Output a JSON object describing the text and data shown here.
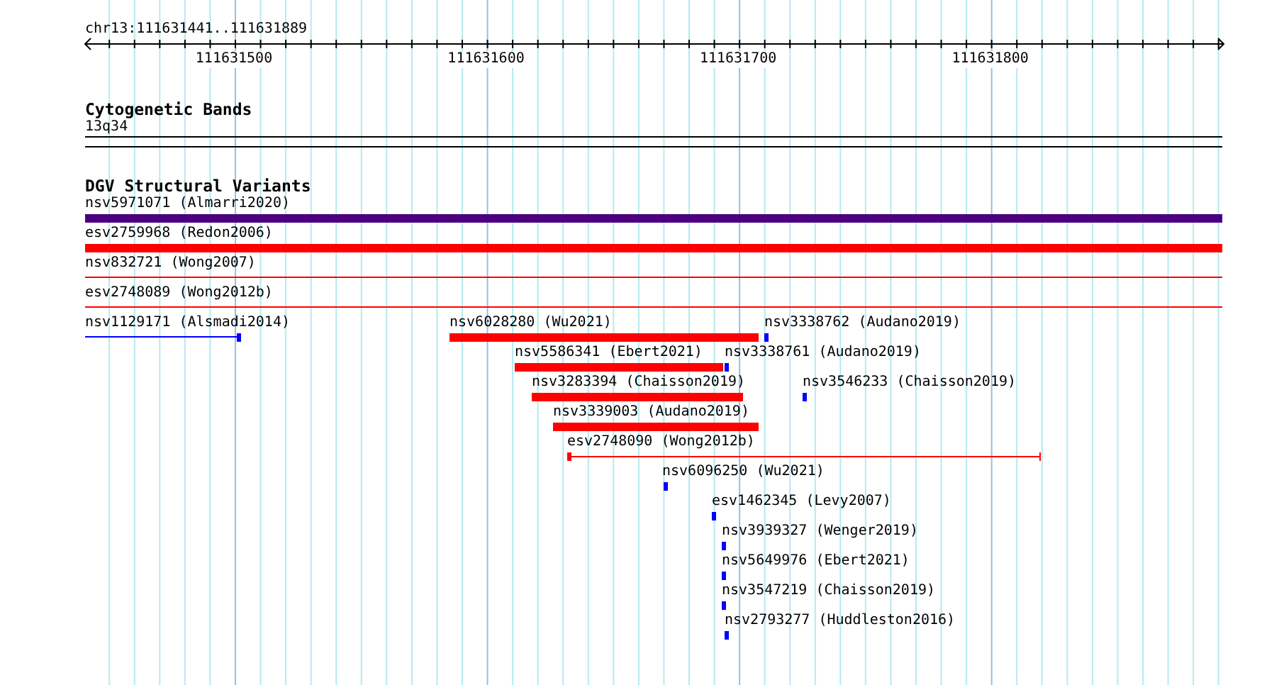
{
  "location": "chr13:111631441..111631889",
  "ruler": {
    "ticks": [
      "111631500",
      "111631600",
      "111631700",
      "111631800"
    ]
  },
  "cytobands": {
    "title": "Cytogenetic Bands",
    "band": "13q34"
  },
  "variants": {
    "title": "DGV Structural Variants",
    "features": [
      {
        "label": "nsv5971071 (Almarri2020)",
        "kind": "bar",
        "color": "#4b0082"
      },
      {
        "label": "esv2759968 (Redon2006)",
        "kind": "bar",
        "color": "#ff0000"
      },
      {
        "label": "nsv832721 (Wong2007)",
        "kind": "line",
        "color": "#ff0000"
      },
      {
        "label": "esv2748089 (Wong2012b)",
        "kind": "line",
        "color": "#ff0000"
      },
      {
        "label": "nsv1129171 (Alsmadi2014)",
        "kind": "tail",
        "color": "#0000ff"
      },
      {
        "label": "nsv6028280 (Wu2021)",
        "kind": "bar",
        "color": "#ff0000"
      },
      {
        "label": "nsv3338762 (Audano2019)",
        "kind": "point",
        "color": "#0000ff"
      },
      {
        "label": "nsv5586341 (Ebert2021)",
        "kind": "bar",
        "color": "#ff0000"
      },
      {
        "label": "nsv3338761 (Audano2019)",
        "kind": "point",
        "color": "#0000ff"
      },
      {
        "label": "nsv3283394 (Chaisson2019)",
        "kind": "bar",
        "color": "#ff0000"
      },
      {
        "label": "nsv3546233 (Chaisson2019)",
        "kind": "point",
        "color": "#0000ff"
      },
      {
        "label": "nsv3339003 (Audano2019)",
        "kind": "bar",
        "color": "#ff0000"
      },
      {
        "label": "esv2748090 (Wong2012b)",
        "kind": "span",
        "color": "#ff0000"
      },
      {
        "label": "nsv6096250 (Wu2021)",
        "kind": "point",
        "color": "#0000ff"
      },
      {
        "label": "esv1462345 (Levy2007)",
        "kind": "point",
        "color": "#0000ff"
      },
      {
        "label": "nsv3939327 (Wenger2019)",
        "kind": "point",
        "color": "#0000ff"
      },
      {
        "label": "nsv5649976 (Ebert2021)",
        "kind": "point",
        "color": "#0000ff"
      },
      {
        "label": "nsv3547219 (Chaisson2019)",
        "kind": "point",
        "color": "#0000ff"
      },
      {
        "label": "nsv2793277 (Huddleston2016)",
        "kind": "point",
        "color": "#0000ff"
      }
    ]
  }
}
